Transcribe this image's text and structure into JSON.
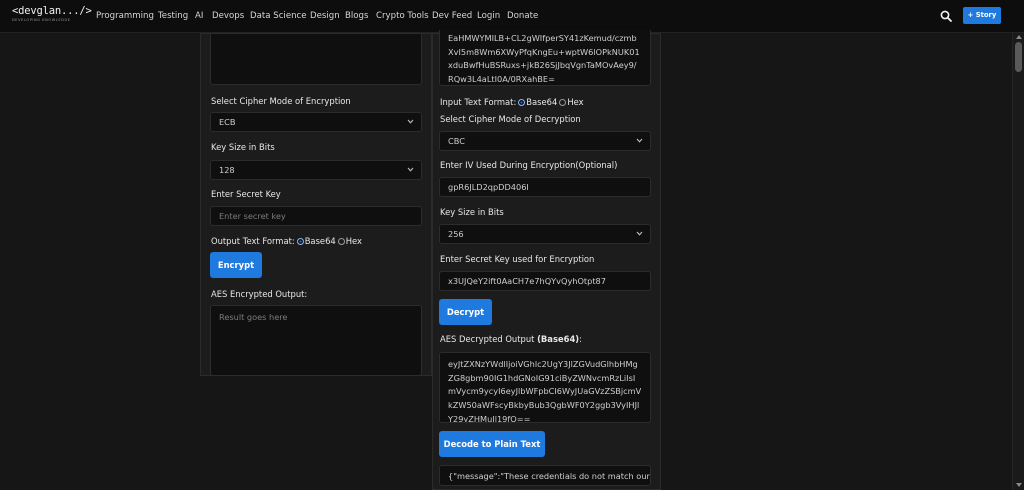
{
  "nav": {
    "logo_text": "<devglan.../>",
    "logo_tagline": "DEVELOPING KNOWLEDGE",
    "links": [
      "Programming",
      "Testing",
      "AI",
      "Devops",
      "Data Science",
      "Design",
      "Blogs",
      "Crypto Tools",
      "Dev Feed",
      "Login",
      "Donate"
    ],
    "story_button": "+ Story",
    "search_icon": "search-icon"
  },
  "encrypt": {
    "cipher_mode_label": "Select Cipher Mode of Encryption",
    "cipher_mode_value": "ECB",
    "key_size_label": "Key Size in Bits",
    "key_size_value": "128",
    "secret_key_label": "Enter Secret Key",
    "secret_key_placeholder": "Enter secret key",
    "output_format_label": "Output Text Format:",
    "format_base64": "Base64",
    "format_hex": "Hex",
    "encrypt_button": "Encrypt",
    "output_label": "AES Encrypted Output:",
    "output_placeholder": "Result goes here"
  },
  "decrypt": {
    "input_text": "EaHMWYMILB+CL2gWIfperSY41zKemud/czmbXvI5m8Wm6XWyPfqKngEu+wptW6lOPkNUK01xduBwfHuBSRuxs+jkB26SjJbqVgnTaMOvAey9/RQw3L4aLtI0A/0RXahBE=",
    "input_format_label": "Input Text Format:",
    "format_base64": "Base64",
    "format_hex": "Hex",
    "cipher_mode_label": "Select Cipher Mode of Decryption",
    "cipher_mode_value": "CBC",
    "iv_label": "Enter IV Used During Encryption(Optional)",
    "iv_value": "gpR6JLD2qpDD406I",
    "key_size_label": "Key Size in Bits",
    "key_size_value": "256",
    "secret_key_label": "Enter Secret Key used for Encryption",
    "secret_key_value": "x3UJQeY2ift0AaCH7e7hQYvQyhOtpt87",
    "decrypt_button": "Decrypt",
    "output_label_prefix": "AES Decrypted Output ",
    "output_label_bold": "(Base64)",
    "output_label_suffix": ":",
    "output_value": "eyJtZXNzYWdlIjoiVGhlc2UgY3JlZGVudGlhbHMgZG8gbm90IG1hdGNoIG91ciByZWNvcmRzLiIsImVycm9ycyI6eyJlbWFpbCI6WyJUaGVzZSBjcmVkZW50aWFscyBkbyBub3QgbWF0Y2ggb3VyIHJlY29yZHMuIl19fQ==",
    "decode_button": "Decode to Plain Text",
    "plain_text_value": "{\"message\":\"These credentials do not match our records.\",\"errors\":{\"email\":[\"These credentials do not match our records.\"]}}"
  }
}
